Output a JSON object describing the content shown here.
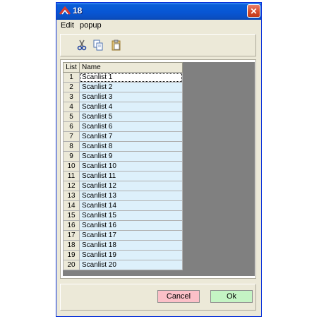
{
  "window": {
    "title": "18"
  },
  "menu": {
    "items": [
      "Edit",
      "popup"
    ]
  },
  "toolbar": {
    "icons": [
      "cut-icon",
      "copy-icon",
      "paste-icon"
    ]
  },
  "table": {
    "headers": {
      "number": "List",
      "name": "Name"
    },
    "rows": [
      {
        "num": "1",
        "name": "Scanlist 1"
      },
      {
        "num": "2",
        "name": "Scanlist 2"
      },
      {
        "num": "3",
        "name": "Scanlist 3"
      },
      {
        "num": "4",
        "name": "Scanlist 4"
      },
      {
        "num": "5",
        "name": "Scanlist 5"
      },
      {
        "num": "6",
        "name": "Scanlist 6"
      },
      {
        "num": "7",
        "name": "Scanlist 7"
      },
      {
        "num": "8",
        "name": "Scanlist 8"
      },
      {
        "num": "9",
        "name": "Scanlist 9"
      },
      {
        "num": "10",
        "name": "Scanlist 10"
      },
      {
        "num": "11",
        "name": "Scanlist 11"
      },
      {
        "num": "12",
        "name": "Scanlist 12"
      },
      {
        "num": "13",
        "name": "Scanlist 13"
      },
      {
        "num": "14",
        "name": "Scanlist 14"
      },
      {
        "num": "15",
        "name": "Scanlist 15"
      },
      {
        "num": "16",
        "name": "Scanlist 16"
      },
      {
        "num": "17",
        "name": "Scanlist 17"
      },
      {
        "num": "18",
        "name": "Scanlist 18"
      },
      {
        "num": "19",
        "name": "Scanlist 19"
      },
      {
        "num": "20",
        "name": "Scanlist 20"
      }
    ]
  },
  "buttons": {
    "cancel": "Cancel",
    "ok": "Ok"
  },
  "colors": {
    "titlebar": "#0856d4",
    "cancel_bg": "#fbc0c8",
    "ok_bg": "#c4f4c4",
    "row_bg": "#ddf0fb"
  }
}
